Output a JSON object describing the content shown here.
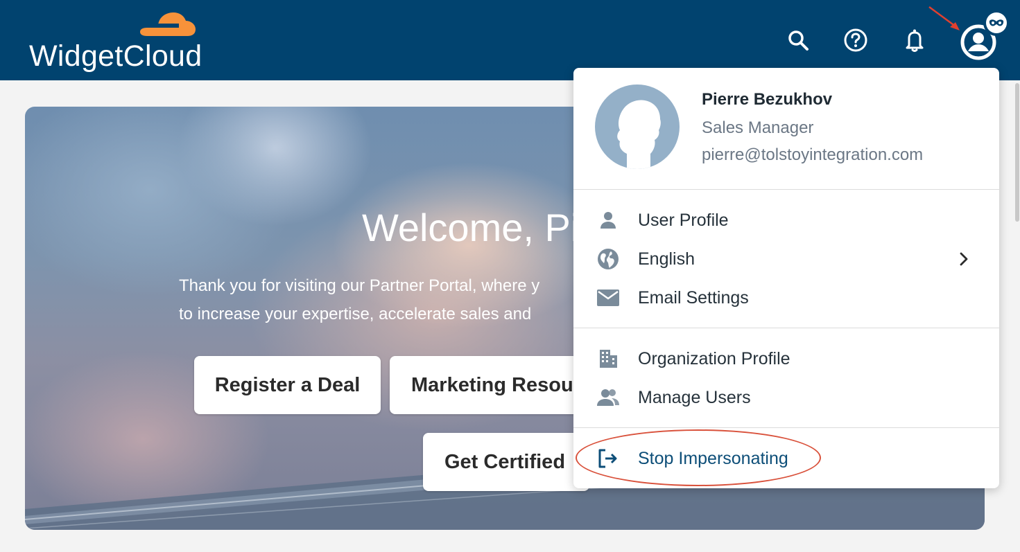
{
  "header": {
    "brand": "WidgetCloud",
    "icons": [
      "search-icon",
      "help-icon",
      "bell-icon",
      "account-icon",
      "mask-icon"
    ]
  },
  "hero": {
    "title": "Welcome, Pi",
    "line1": "Thank you for visiting our Partner Portal, where y",
    "line2": "to increase your expertise, accelerate sales and",
    "buttons": {
      "register": "Register a Deal",
      "marketing": "Marketing Resou",
      "certified": "Get Certified"
    }
  },
  "dropdown": {
    "user": {
      "name": "Pierre Bezukhov",
      "role": "Sales Manager",
      "email": "pierre@tolstoyintegration.com"
    },
    "items": {
      "user_profile": "User Profile",
      "language": "English",
      "email_settings": "Email Settings",
      "organization_profile": "Organization Profile",
      "manage_users": "Manage Users",
      "stop_impersonating": "Stop Impersonating"
    }
  },
  "colors": {
    "header_bg": "#01436f",
    "accent_orange": "#f7923a",
    "icon_grey": "#7a8b9a",
    "highlight_red": "#d9513b"
  }
}
